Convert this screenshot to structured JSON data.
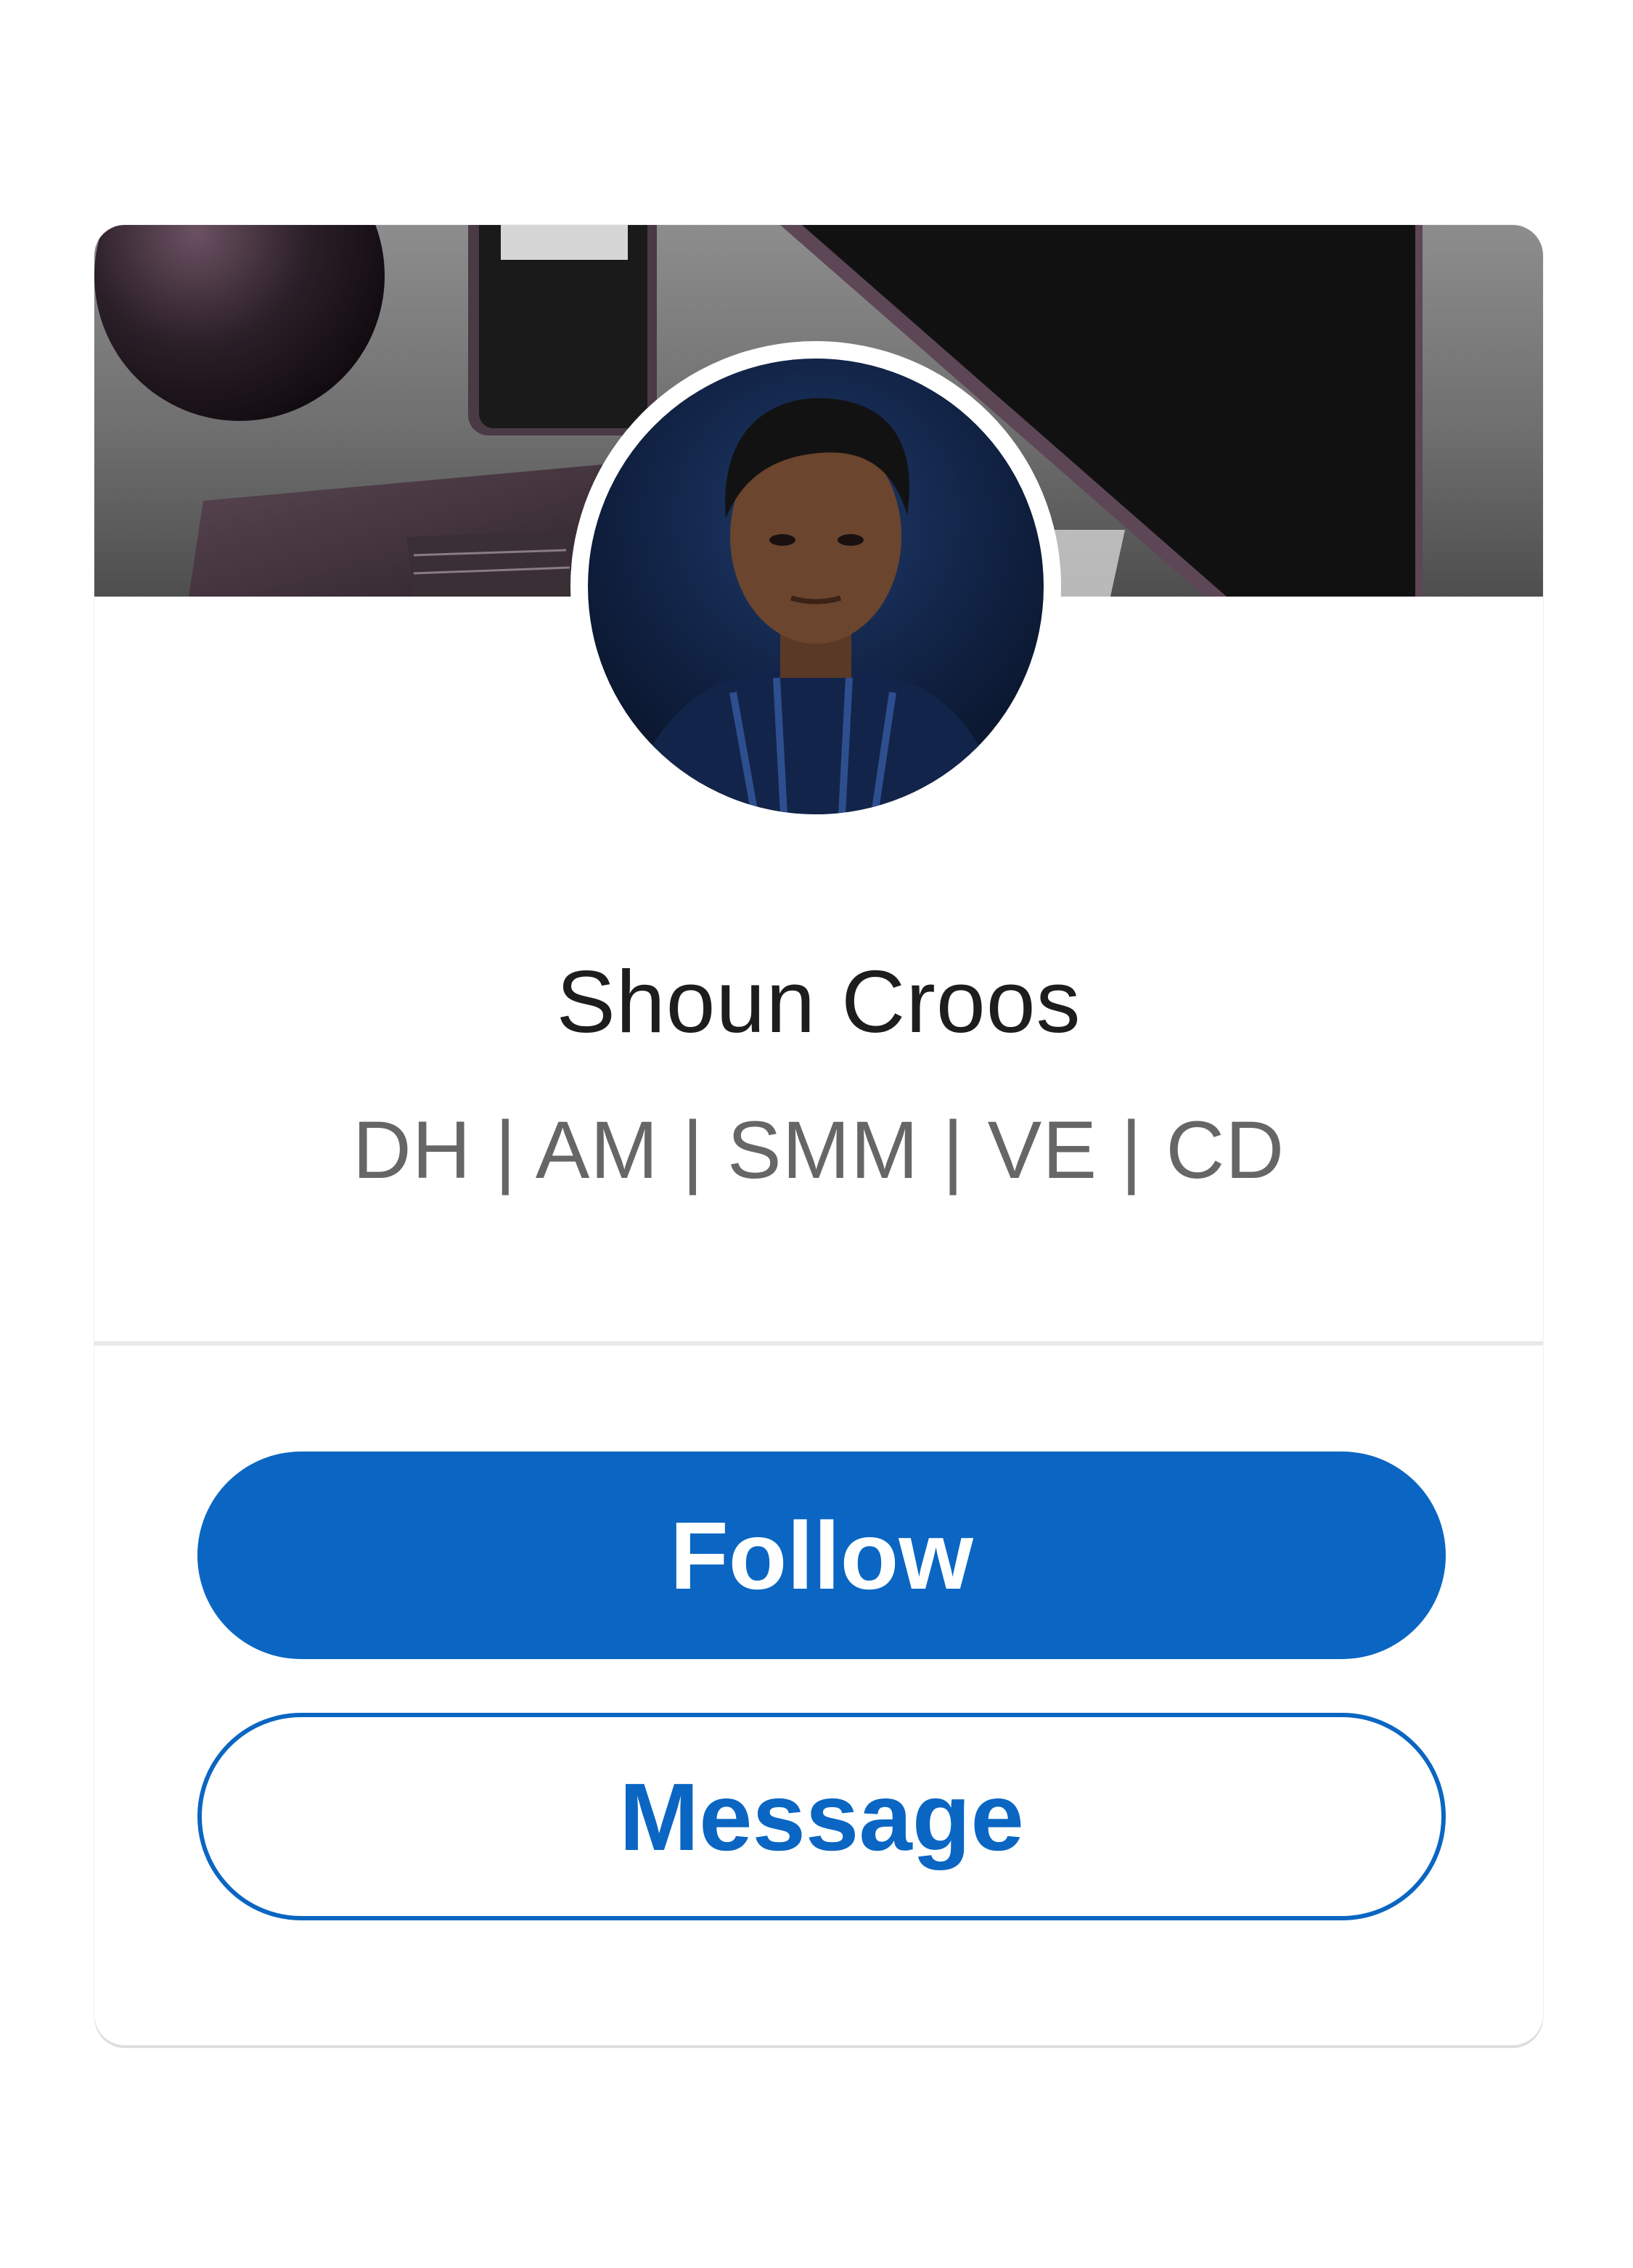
{
  "profile": {
    "name": "Shoun Croos",
    "headline": "DH | AM | SMM | VE | CD"
  },
  "actions": {
    "follow_label": "Follow",
    "message_label": "Message"
  },
  "banner": {
    "description_icon": "devices-photo"
  },
  "colors": {
    "brand_blue": "#0a66c2",
    "name_text": "#1d1d1d",
    "headline_text": "#666666",
    "divider": "#e9e9e9"
  }
}
